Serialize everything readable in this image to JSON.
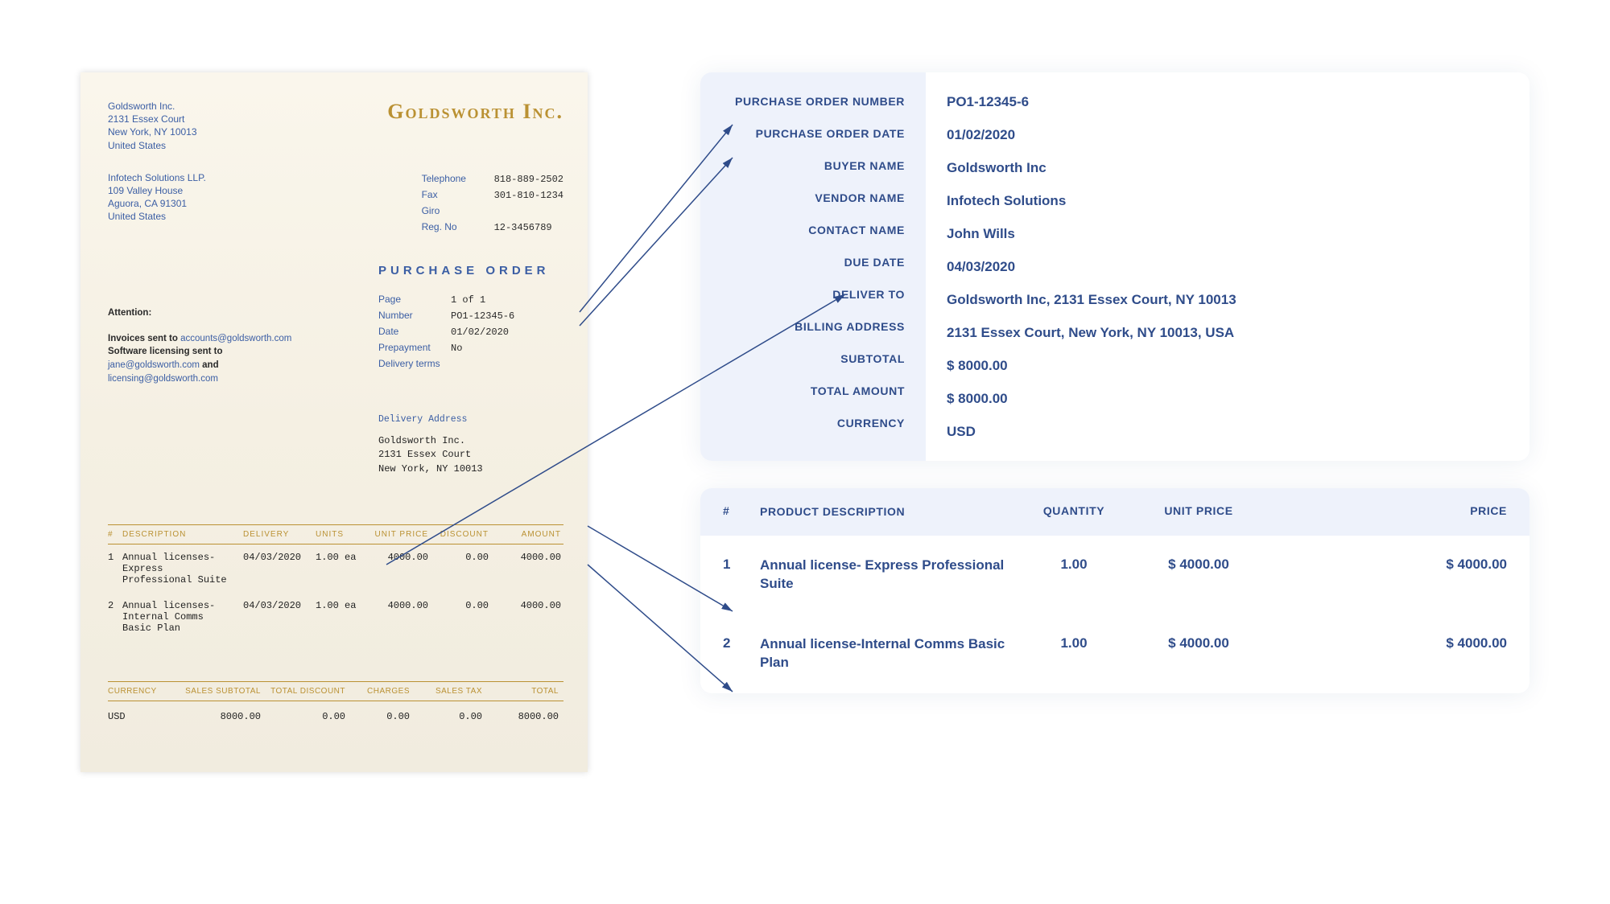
{
  "doc": {
    "company_title": "Goldsworth Inc.",
    "buyer_addr": "Goldsworth Inc.\n2131 Essex Court\nNew York, NY 10013\nUnited States",
    "vendor_addr": "Infotech Solutions LLP.\n109 Valley House\nAguora, CA 91301\nUnited States",
    "meta_labels": {
      "tel": "Telephone",
      "fax": "Fax",
      "giro": "Giro",
      "reg": "Reg. No"
    },
    "meta_vals": {
      "tel": "818-889-2502",
      "fax": "301-810-1234",
      "giro": "",
      "reg": "12-3456789"
    },
    "section_title": "PURCHASE ORDER",
    "attention": "Attention:",
    "notice_invoices_pre": "Invoices sent to ",
    "notice_invoices_email": "accounts@goldsworth.com",
    "notice_sw_pre": "Software licensing sent to",
    "notice_sw_email1": "jane@goldsworth.com",
    "notice_and": " and",
    "notice_sw_email2": "licensing@goldsworth.com",
    "po_labels": {
      "page": "Page",
      "number": "Number",
      "date": "Date",
      "prepay": "Prepayment",
      "delterms": "Delivery terms"
    },
    "po_vals": {
      "page": "1 of 1",
      "number": "PO1-12345-6",
      "date": "01/02/2020",
      "prepay": "No",
      "delterms": ""
    },
    "deliver_label": "Delivery Address",
    "deliver_body": "Goldsworth Inc.\n2131 Essex Court\nNew York, NY 10013",
    "items_head": {
      "idx": "#",
      "desc": "DESCRIPTION",
      "del": "DELIVERY",
      "units": "UNITS",
      "up": "UNIT PRICE",
      "disc": "DISCOUNT",
      "amt": "AMOUNT"
    },
    "items": [
      {
        "idx": "1",
        "desc": "Annual licenses- Express Professional Suite",
        "del": "04/03/2020",
        "units": "1.00 ea",
        "up": "4000.00",
        "disc": "0.00",
        "amt": "4000.00"
      },
      {
        "idx": "2",
        "desc": "Annual licenses- Internal Comms Basic Plan",
        "del": "04/03/2020",
        "units": "1.00 ea",
        "up": "4000.00",
        "disc": "0.00",
        "amt": "4000.00"
      }
    ],
    "totals_head": {
      "cur": "CURRENCY",
      "sub": "SALES SUBTOTAL",
      "disc": "TOTAL DISCOUNT",
      "chg": "CHARGES",
      "tax": "SALES TAX",
      "tot": "TOTAL"
    },
    "totals": {
      "cur": "USD",
      "sub": "8000.00",
      "disc": "0.00",
      "chg": "0.00",
      "tax": "0.00",
      "tot": "8000.00"
    }
  },
  "card": {
    "labels": {
      "po_num": "PURCHASE ORDER NUMBER",
      "po_date": "PURCHASE ORDER DATE",
      "buyer": "BUYER NAME",
      "vendor": "VENDOR NAME",
      "contact": "CONTACT NAME",
      "due": "DUE DATE",
      "deliver": "DELIVER TO",
      "billing": "BILLING ADDRESS",
      "subtotal": "SUBTOTAL",
      "total": "TOTAL AMOUNT",
      "currency": "CURRENCY"
    },
    "values": {
      "po_num": "PO1-12345-6",
      "po_date": "01/02/2020",
      "buyer": "Goldsworth Inc",
      "vendor": "Infotech Solutions",
      "contact": "John Wills",
      "due": "04/03/2020",
      "deliver": "Goldsworth Inc, 2131 Essex Court, NY 10013",
      "billing": "2131 Essex Court, New York, NY 10013, USA",
      "subtotal": "$ 8000.00",
      "total": "$ 8000.00",
      "currency": "USD"
    }
  },
  "products": {
    "head": {
      "idx": "#",
      "desc": "PRODUCT DESCRIPTION",
      "qty": "QUANTITY",
      "up": "UNIT PRICE",
      "price": "PRICE"
    },
    "rows": [
      {
        "idx": "1",
        "desc": "Annual license- Express Professional Suite",
        "qty": "1.00",
        "up": "$ 4000.00",
        "price": "$ 4000.00"
      },
      {
        "idx": "2",
        "desc": "Annual license-Internal Comms Basic Plan",
        "qty": "1.00",
        "up": "$ 4000.00",
        "price": "$ 4000.00"
      }
    ]
  }
}
